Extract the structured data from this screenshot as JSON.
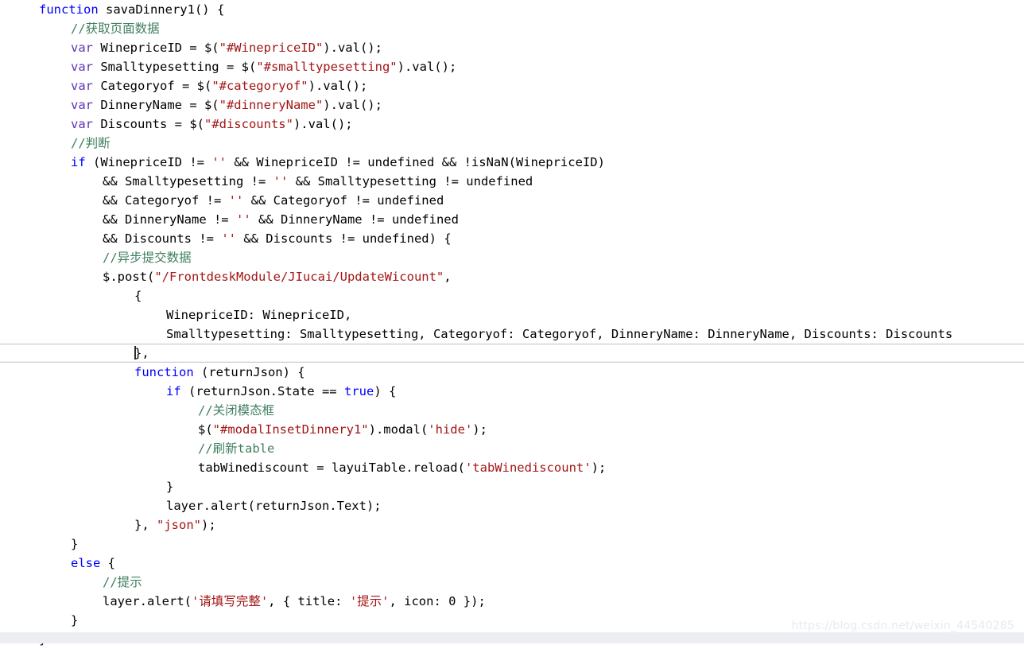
{
  "editor": {
    "language": "javascript",
    "theme_background": "#ffffff",
    "colors": {
      "keyword": "#0000ff",
      "variable_keyword": "#5e35b1",
      "string": "#a31515",
      "comment": "#3f7f5f",
      "text": "#000000",
      "current_line_border": "#c9c9d6",
      "watermark": "#e8eaef",
      "bottom_bar": "#eceef3"
    },
    "current_line_index": 18,
    "caret_line_index": 18
  },
  "watermark": {
    "text": "https://blog.csdn.net/weixin_44540285"
  },
  "code": {
    "lines": [
      {
        "indent": 0,
        "tokens": [
          {
            "t": "kw",
            "v": "function"
          },
          {
            "t": "plain",
            "v": " savaDinnery1() {"
          }
        ]
      },
      {
        "indent": 1,
        "tokens": [
          {
            "t": "cmt",
            "v": "//获取页面数据"
          }
        ]
      },
      {
        "indent": 1,
        "tokens": [
          {
            "t": "var",
            "v": "var"
          },
          {
            "t": "plain",
            "v": " WinepriceID = $("
          },
          {
            "t": "str",
            "v": "\"#WinepriceID\""
          },
          {
            "t": "plain",
            "v": ").val();"
          }
        ]
      },
      {
        "indent": 1,
        "tokens": [
          {
            "t": "var",
            "v": "var"
          },
          {
            "t": "plain",
            "v": " Smalltypesetting = $("
          },
          {
            "t": "str",
            "v": "\"#smalltypesetting\""
          },
          {
            "t": "plain",
            "v": ").val();"
          }
        ]
      },
      {
        "indent": 1,
        "tokens": [
          {
            "t": "var",
            "v": "var"
          },
          {
            "t": "plain",
            "v": " Categoryof = $("
          },
          {
            "t": "str",
            "v": "\"#categoryof\""
          },
          {
            "t": "plain",
            "v": ").val();"
          }
        ]
      },
      {
        "indent": 1,
        "tokens": [
          {
            "t": "var",
            "v": "var"
          },
          {
            "t": "plain",
            "v": " DinneryName = $("
          },
          {
            "t": "str",
            "v": "\"#dinneryName\""
          },
          {
            "t": "plain",
            "v": ").val();"
          }
        ]
      },
      {
        "indent": 1,
        "tokens": [
          {
            "t": "var",
            "v": "var"
          },
          {
            "t": "plain",
            "v": " Discounts = $("
          },
          {
            "t": "str",
            "v": "\"#discounts\""
          },
          {
            "t": "plain",
            "v": ").val();"
          }
        ]
      },
      {
        "indent": 1,
        "tokens": [
          {
            "t": "cmt",
            "v": "//判断"
          }
        ]
      },
      {
        "indent": 1,
        "tokens": [
          {
            "t": "kw",
            "v": "if"
          },
          {
            "t": "plain",
            "v": " (WinepriceID != "
          },
          {
            "t": "str",
            "v": "''"
          },
          {
            "t": "plain",
            "v": " && WinepriceID != undefined && !isNaN(WinepriceID)"
          }
        ]
      },
      {
        "indent": 2,
        "tokens": [
          {
            "t": "plain",
            "v": "&& Smalltypesetting != "
          },
          {
            "t": "str",
            "v": "''"
          },
          {
            "t": "plain",
            "v": " && Smalltypesetting != undefined"
          }
        ]
      },
      {
        "indent": 2,
        "tokens": [
          {
            "t": "plain",
            "v": "&& Categoryof != "
          },
          {
            "t": "str",
            "v": "''"
          },
          {
            "t": "plain",
            "v": " && Categoryof != undefined"
          }
        ]
      },
      {
        "indent": 2,
        "tokens": [
          {
            "t": "plain",
            "v": "&& DinneryName != "
          },
          {
            "t": "str",
            "v": "''"
          },
          {
            "t": "plain",
            "v": " && DinneryName != undefined"
          }
        ]
      },
      {
        "indent": 2,
        "tokens": [
          {
            "t": "plain",
            "v": "&& Discounts != "
          },
          {
            "t": "str",
            "v": "''"
          },
          {
            "t": "plain",
            "v": " && Discounts != undefined) {"
          }
        ]
      },
      {
        "indent": 2,
        "tokens": [
          {
            "t": "cmt",
            "v": "//异步提交数据"
          }
        ]
      },
      {
        "indent": 2,
        "tokens": [
          {
            "t": "plain",
            "v": "$.post("
          },
          {
            "t": "str",
            "v": "\"/FrontdeskModule/JIucai/UpdateWicount\""
          },
          {
            "t": "plain",
            "v": ","
          }
        ]
      },
      {
        "indent": 3,
        "tokens": [
          {
            "t": "plain",
            "v": "{"
          }
        ]
      },
      {
        "indent": 4,
        "tokens": [
          {
            "t": "plain",
            "v": "WinepriceID: WinepriceID,"
          }
        ]
      },
      {
        "indent": 4,
        "tokens": [
          {
            "t": "plain",
            "v": "Smalltypesetting: Smalltypesetting, Categoryof: Categoryof, DinneryName: DinneryName, Discounts: Discounts"
          }
        ]
      },
      {
        "indent": 3,
        "current": true,
        "caret": true,
        "tokens": [
          {
            "t": "plain",
            "v": "},"
          }
        ]
      },
      {
        "indent": 3,
        "tokens": [
          {
            "t": "kw",
            "v": "function"
          },
          {
            "t": "plain",
            "v": " (returnJson) {"
          }
        ]
      },
      {
        "indent": 4,
        "tokens": [
          {
            "t": "kw",
            "v": "if"
          },
          {
            "t": "plain",
            "v": " (returnJson.State == "
          },
          {
            "t": "kw",
            "v": "true"
          },
          {
            "t": "plain",
            "v": ") {"
          }
        ]
      },
      {
        "indent": 5,
        "tokens": [
          {
            "t": "cmt",
            "v": "//关闭模态框"
          }
        ]
      },
      {
        "indent": 5,
        "tokens": [
          {
            "t": "plain",
            "v": "$("
          },
          {
            "t": "str",
            "v": "\"#modalInsetDinnery1\""
          },
          {
            "t": "plain",
            "v": ").modal("
          },
          {
            "t": "str",
            "v": "'hide'"
          },
          {
            "t": "plain",
            "v": ");"
          }
        ]
      },
      {
        "indent": 5,
        "tokens": [
          {
            "t": "cmt",
            "v": "//刷新table"
          }
        ]
      },
      {
        "indent": 5,
        "tokens": [
          {
            "t": "plain",
            "v": "tabWinediscount = layuiTable.reload("
          },
          {
            "t": "str",
            "v": "'tabWinediscount'"
          },
          {
            "t": "plain",
            "v": ");"
          }
        ]
      },
      {
        "indent": 4,
        "tokens": [
          {
            "t": "plain",
            "v": "}"
          }
        ]
      },
      {
        "indent": 4,
        "tokens": [
          {
            "t": "plain",
            "v": "layer.alert(returnJson.Text);"
          }
        ]
      },
      {
        "indent": 3,
        "tokens": [
          {
            "t": "plain",
            "v": "}, "
          },
          {
            "t": "str",
            "v": "\"json\""
          },
          {
            "t": "plain",
            "v": ");"
          }
        ]
      },
      {
        "indent": 1,
        "tokens": [
          {
            "t": "plain",
            "v": "}"
          }
        ]
      },
      {
        "indent": 1,
        "tokens": [
          {
            "t": "kw",
            "v": "else"
          },
          {
            "t": "plain",
            "v": " {"
          }
        ]
      },
      {
        "indent": 2,
        "tokens": [
          {
            "t": "cmt",
            "v": "//提示"
          }
        ]
      },
      {
        "indent": 2,
        "tokens": [
          {
            "t": "plain",
            "v": "layer.alert("
          },
          {
            "t": "str",
            "v": "'请填写完整'"
          },
          {
            "t": "plain",
            "v": ", { title: "
          },
          {
            "t": "str",
            "v": "'提示'"
          },
          {
            "t": "plain",
            "v": ", icon: 0 });"
          }
        ]
      },
      {
        "indent": 1,
        "tokens": [
          {
            "t": "plain",
            "v": "}"
          }
        ]
      },
      {
        "indent": 0,
        "tokens": [
          {
            "t": "plain",
            "v": "}"
          }
        ]
      }
    ]
  }
}
